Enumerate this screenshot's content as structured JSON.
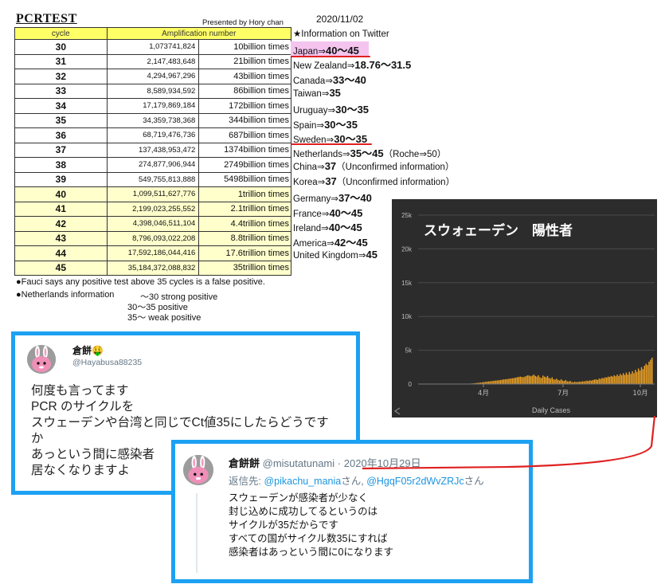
{
  "header": {
    "title": "PCRTEST",
    "presented_by": "Presented by Hory chan",
    "date": "2020/11/02"
  },
  "table": {
    "headers": [
      "cycle",
      "Amplification number"
    ],
    "rows": [
      {
        "cycle": "30",
        "number": "1,073741,824",
        "times": "10billion times"
      },
      {
        "cycle": "31",
        "number": "2,147,483,648",
        "times": "21billion times"
      },
      {
        "cycle": "32",
        "number": "4,294,967,296",
        "times": "43billion times"
      },
      {
        "cycle": "33",
        "number": "8,589,934,592",
        "times": "86billion times"
      },
      {
        "cycle": "34",
        "number": "17,179,869,184",
        "times": "172billion times"
      },
      {
        "cycle": "35",
        "number": "34,359,738,368",
        "times": "344billion times"
      },
      {
        "cycle": "36",
        "number": "68,719,476,736",
        "times": "687billion times"
      },
      {
        "cycle": "37",
        "number": "137,438,953,472",
        "times": "1374billion times"
      },
      {
        "cycle": "38",
        "number": "274,877,906,944",
        "times": "2749billion times"
      },
      {
        "cycle": "39",
        "number": "549,755,813,888",
        "times": "5498billion times"
      },
      {
        "cycle": "40",
        "number": "1,099,511,627,776",
        "times": "1trillion times"
      },
      {
        "cycle": "41",
        "number": "2,199,023,255,552",
        "times": "2.1trillion times"
      },
      {
        "cycle": "42",
        "number": "4,398,046,511,104",
        "times": "4.4trillion times"
      },
      {
        "cycle": "43",
        "number": "8,796,093,022,208",
        "times": "8.8trillion times"
      },
      {
        "cycle": "44",
        "number": "17,592,186,044,416",
        "times": "17.6trillion times"
      },
      {
        "cycle": "45",
        "number": "35,184,372,088,832",
        "times": "35trillion times"
      }
    ]
  },
  "info": {
    "heading": "★Information on Twitter",
    "items": [
      {
        "country": "Japan⇒",
        "value": "40～45",
        "note": ""
      },
      {
        "country": "New Zealand⇒",
        "value": "18.76～31.5",
        "note": ""
      },
      {
        "country": "Canada⇒",
        "value": "33～40",
        "note": ""
      },
      {
        "country": "Taiwan⇒",
        "value": "35",
        "note": ""
      },
      {
        "country": "Uruguay⇒",
        "value": "30～35",
        "note": ""
      },
      {
        "country": "Spain⇒",
        "value": "30～35",
        "note": ""
      },
      {
        "country": "Sweden⇒",
        "value": "30～35",
        "note": ""
      },
      {
        "country": "Netherlands⇒",
        "value": "35～45",
        "note": "（Roche⇒50）"
      },
      {
        "country": "China⇒",
        "value": "37",
        "note": "（Unconfirmed information）"
      },
      {
        "country": "Korea⇒",
        "value": "37",
        "note": "（Unconfirmed information）"
      },
      {
        "country": "Germany⇒",
        "value": "37～40",
        "note": ""
      },
      {
        "country": "France⇒",
        "value": "40～45",
        "note": ""
      },
      {
        "country": "Ireland⇒",
        "value": "40～45",
        "note": ""
      },
      {
        "country": "America⇒",
        "value": "42～45",
        "note": ""
      },
      {
        "country": "United Kingdom⇒",
        "value": "45",
        "note": ""
      }
    ]
  },
  "notes": {
    "fauci": "●Fauci says any positive test above 35 cycles is a false positive.",
    "netherlands_head": "●Netherlands information",
    "line1": "～30 strong positive",
    "line2": "30～35 positive",
    "line3": "35～    weak positive"
  },
  "tweet1": {
    "name": "倉餅🤑",
    "handle": "@Hayabusa88235",
    "body": [
      "何度も言ってます",
      "PCR のサイクルを",
      "スウェーデンや台湾と同じでCt値35にしたらどうです",
      "か",
      "あっという間に感染者",
      "居なくなりますよ"
    ]
  },
  "tweet2": {
    "name": "倉餅餅",
    "handle": "@misutatunami",
    "dot": "·",
    "date": "2020年10月29日",
    "reply_prefix": "返信先: ",
    "reply_to_1": "@pikachu_mania",
    "reply_san_1": "さん, ",
    "reply_to_2": "@HgqF05r2dWvZRJc",
    "reply_san_2": "さん",
    "body": [
      "スウェーデンが感染者が少なく",
      "封じ込めに成功してるというのは",
      "サイクルが35だからです",
      "すべての国がサイクル数35にすれば",
      "感染者はあっという間に0になります"
    ]
  },
  "chart_data": {
    "type": "bar",
    "title": "スウォェーデン　陽性者",
    "xlabel": "Daily Cases",
    "ylabel": "",
    "ylim": [
      0,
      25000
    ],
    "y_ticks": [
      "0",
      "5k",
      "10k",
      "15k",
      "20k",
      "25k"
    ],
    "x_ticks": [
      "4月",
      "7月",
      "10月"
    ],
    "color": "#f5a623",
    "values": [
      0,
      0,
      0,
      0,
      0,
      0,
      0,
      0,
      0,
      0,
      0,
      0,
      0,
      0,
      0,
      0,
      0,
      0,
      0,
      0,
      0,
      0,
      0,
      0,
      0,
      0,
      0,
      0,
      0,
      0,
      20,
      30,
      40,
      60,
      80,
      100,
      120,
      150,
      180,
      200,
      230,
      260,
      290,
      320,
      350,
      380,
      400,
      430,
      460,
      500,
      520,
      540,
      560,
      600,
      640,
      680,
      700,
      720,
      760,
      800,
      830,
      860,
      900,
      950,
      1000,
      1050,
      1100,
      1050,
      1000,
      1100,
      1200,
      1300,
      1250,
      1150,
      1250,
      1400,
      1200,
      1100,
      1300,
      1000,
      900,
      1250,
      1100,
      1000,
      1200,
      900,
      800,
      1000,
      700,
      650,
      800,
      600,
      520,
      700,
      500,
      450,
      600,
      400,
      380,
      450,
      300,
      250,
      350,
      280,
      300,
      350,
      320,
      400,
      380,
      420,
      500,
      450,
      550,
      500,
      600,
      650,
      700,
      600,
      800,
      750,
      900,
      850,
      1000,
      950,
      1100,
      1050,
      1200,
      1100,
      1300,
      1150,
      1400,
      1200,
      1500,
      1300,
      1600,
      1350,
      1700,
      1400,
      1800,
      1500,
      1900,
      1600,
      2100,
      1800,
      2300,
      2000,
      2500,
      2200,
      2700,
      3000,
      2800,
      3300,
      3600,
      3900
    ]
  }
}
